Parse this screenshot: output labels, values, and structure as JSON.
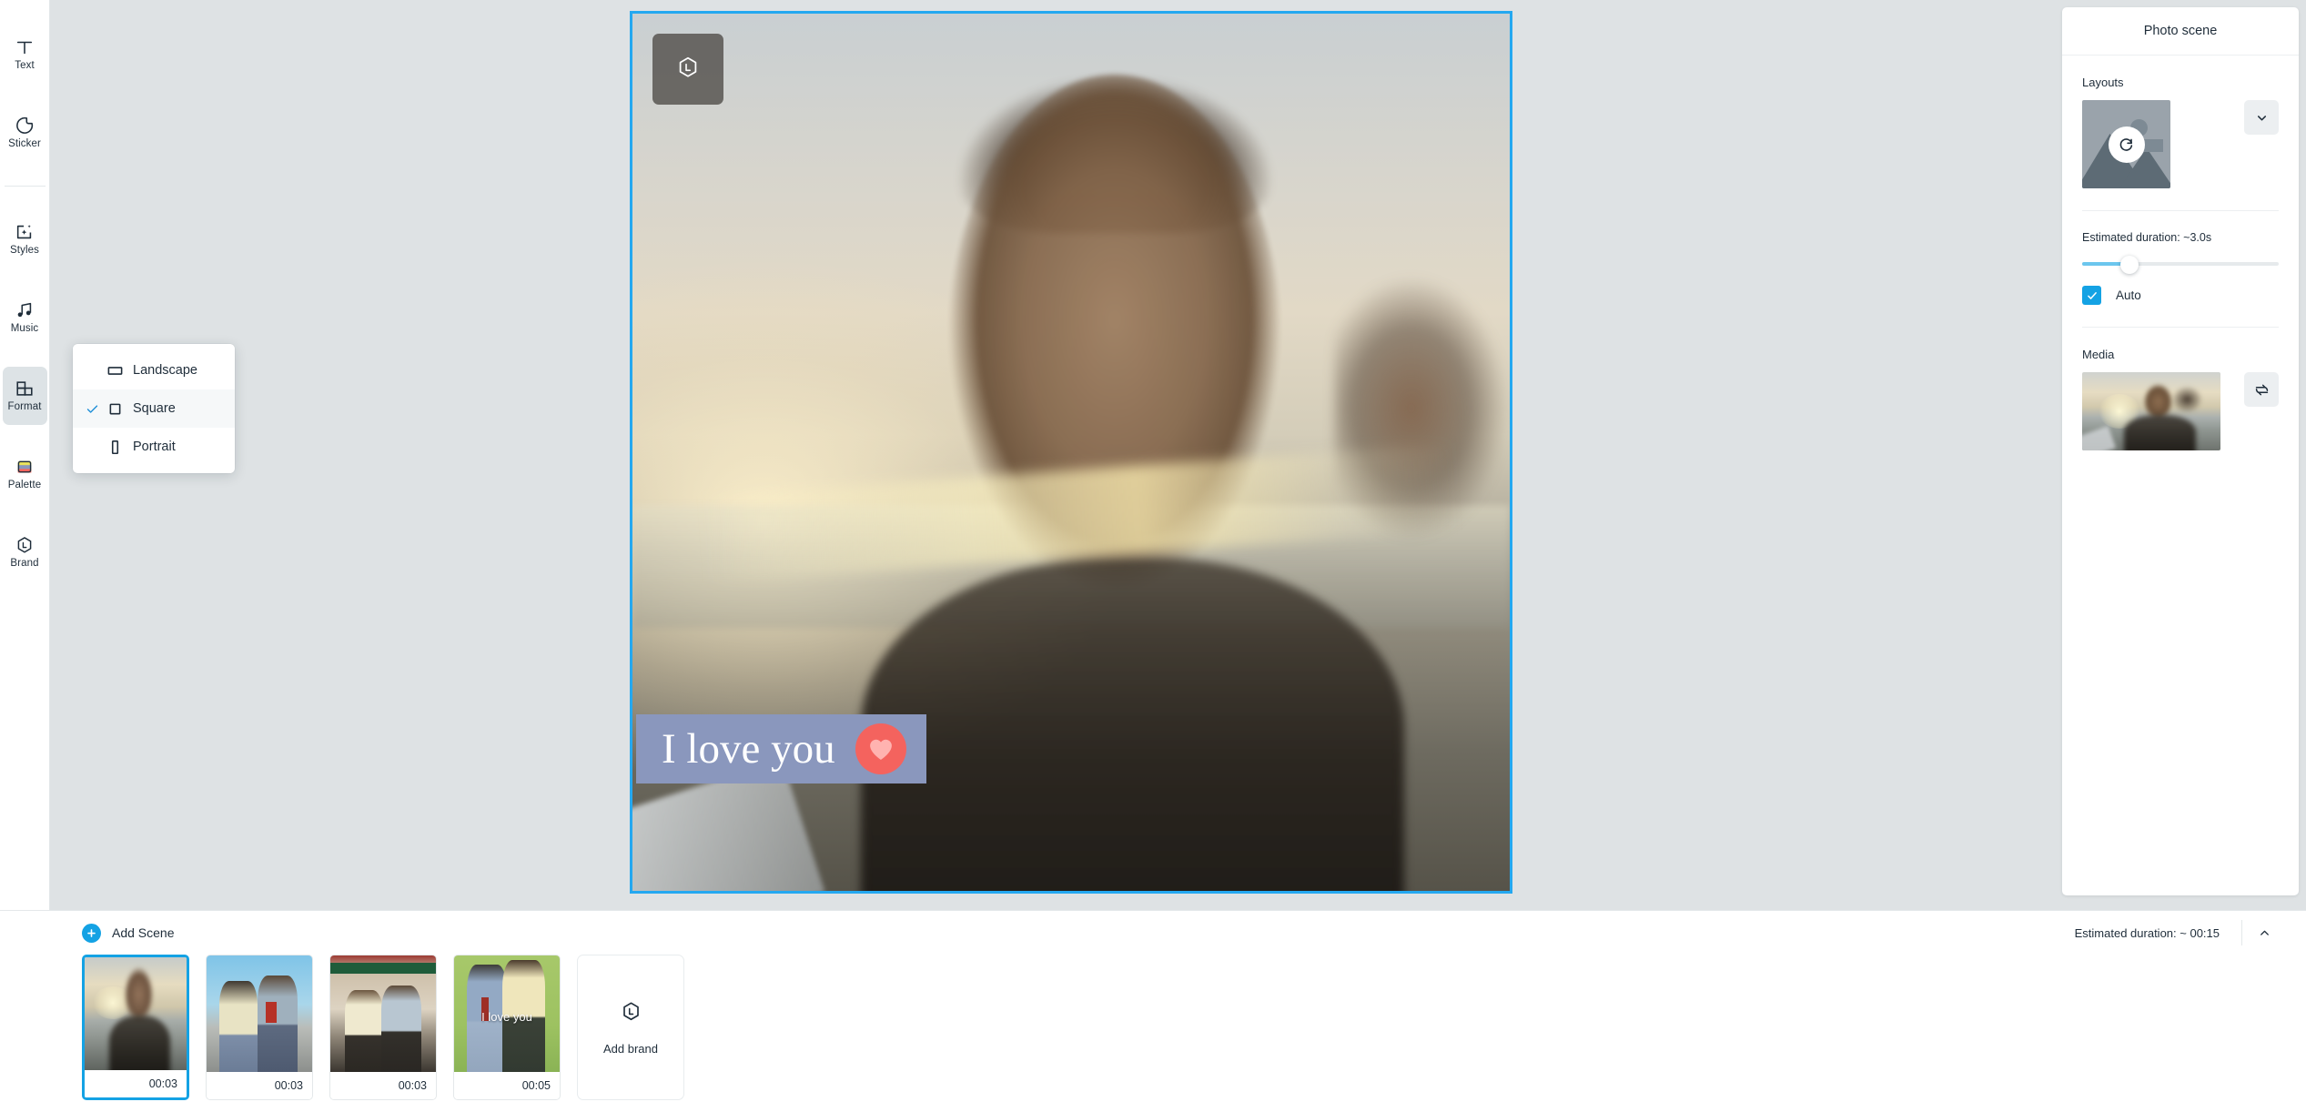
{
  "sidebar": {
    "items": [
      {
        "label": "Text",
        "icon": "text-icon",
        "active": false
      },
      {
        "label": "Sticker",
        "icon": "sticker-icon",
        "active": false
      },
      {
        "label": "Styles",
        "icon": "styles-icon",
        "active": false
      },
      {
        "label": "Music",
        "icon": "music-icon",
        "active": false
      },
      {
        "label": "Format",
        "icon": "format-icon",
        "active": true
      },
      {
        "label": "Palette",
        "icon": "palette-icon",
        "active": false
      },
      {
        "label": "Brand",
        "icon": "brand-icon",
        "active": false
      }
    ]
  },
  "format_menu": {
    "options": [
      {
        "label": "Landscape",
        "icon": "landscape-icon",
        "selected": false
      },
      {
        "label": "Square",
        "icon": "square-icon",
        "selected": true
      },
      {
        "label": "Portrait",
        "icon": "portrait-icon",
        "selected": false
      }
    ]
  },
  "canvas": {
    "aspect": "Square",
    "brand_button_icon": "brand-logo-icon",
    "caption_text": "I love you",
    "caption_emoji_icon": "heart-icon",
    "selection_color": "#24a8f0",
    "caption_bg_color": "#8a97bd",
    "heart_bg_color": "#f4635e"
  },
  "right_panel": {
    "title": "Photo scene",
    "layouts": {
      "label": "Layouts",
      "thumb_icon": "image-placeholder-icon",
      "refresh_icon": "rotate-icon",
      "expand_icon": "chevron-down-icon"
    },
    "duration": {
      "label": "Estimated duration: ~3.0s",
      "slider_value_percent": 24,
      "auto_label": "Auto",
      "auto_checked": true,
      "accent_color": "#14a2e4"
    },
    "media": {
      "label": "Media",
      "replace_icon": "swap-icon"
    }
  },
  "timeline": {
    "add_scene_label": "Add Scene",
    "add_scene_icon": "plus-icon",
    "estimated_duration": "Estimated duration: ~ 00:15",
    "collapse_icon": "chevron-up-icon",
    "scenes": [
      {
        "duration": "00:03",
        "art": "s1",
        "caption": "",
        "selected": true
      },
      {
        "duration": "00:03",
        "art": "s2",
        "caption": "",
        "selected": false
      },
      {
        "duration": "00:03",
        "art": "s3",
        "caption": "",
        "selected": false
      },
      {
        "duration": "00:05",
        "art": "s4",
        "caption": "I love you",
        "selected": false
      }
    ],
    "add_brand": {
      "label": "Add brand",
      "icon": "brand-logo-icon"
    }
  }
}
